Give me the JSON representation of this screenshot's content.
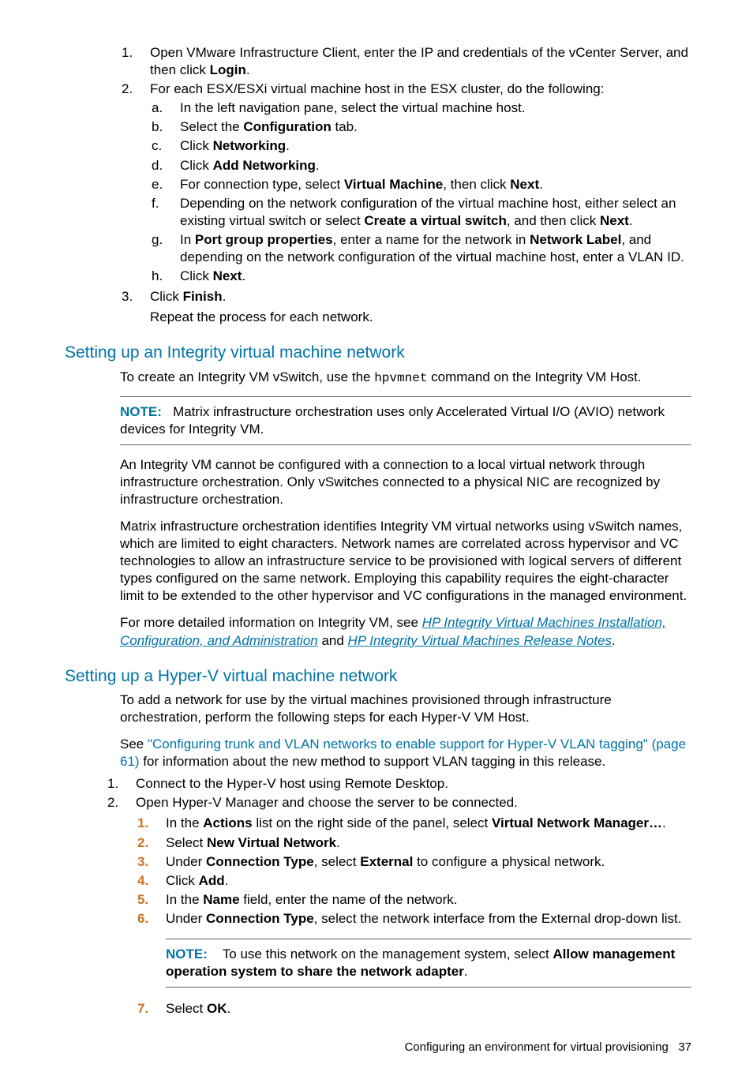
{
  "indent": {
    "l1_top": [
      {
        "n": "1.",
        "pre": "Open VMware Infrastructure Client, enter the IP and credentials of the vCenter Server, and then click ",
        "b1": "Login",
        "post": "."
      },
      {
        "n": "2.",
        "pre": "For each ESX/ESXi virtual machine host in the ESX cluster, do the following:"
      }
    ],
    "l2_letters": {
      "a": {
        "n": "a.",
        "txt": "In the left navigation pane, select the virtual machine host."
      },
      "b": {
        "n": "b.",
        "pre": "Select the ",
        "b1": "Configuration",
        "post": " tab."
      },
      "c": {
        "n": "c.",
        "pre": "Click ",
        "b1": "Networking",
        "post": "."
      },
      "d": {
        "n": "d.",
        "pre": "Click ",
        "b1": "Add Networking",
        "post": "."
      },
      "e": {
        "n": "e.",
        "pre": "For connection type, select ",
        "b1": "Virtual Machine",
        "mid": ", then click ",
        "b2": "Next",
        "post": "."
      },
      "f": {
        "n": "f.",
        "pre": "Depending on the network configuration of the virtual machine host, either select an existing virtual switch or select ",
        "b1": "Create a virtual switch",
        "mid": ", and then click ",
        "b2": "Next",
        "post": "."
      },
      "g": {
        "n": "g.",
        "pre": "In ",
        "b1": "Port group properties",
        "mid": ", enter a name for the network in ",
        "b2": "Network Label",
        "post": ", and depending on the network configuration of the virtual machine host, enter a VLAN ID."
      },
      "h": {
        "n": "h.",
        "pre": "Click ",
        "b1": "Next",
        "post": "."
      }
    },
    "l1_3": {
      "n": "3.",
      "pre": "Click ",
      "b1": "Finish",
      "post": "."
    },
    "l1_3_after": "Repeat the process for each network."
  },
  "s1": {
    "heading": "Setting up an Integrity virtual machine network",
    "intro_pre": "To create an Integrity VM vSwitch, use the ",
    "intro_code": "hpvmnet",
    "intro_post": " command on the Integrity VM Host.",
    "note_label": "NOTE:",
    "note_text": "Matrix infrastructure orchestration uses only Accelerated Virtual I/O (AVIO) network devices for Integrity VM.",
    "p2": "An Integrity VM cannot be configured with a connection to a local virtual network through infrastructure orchestration. Only vSwitches connected to a physical NIC are recognized by infrastructure orchestration.",
    "p3": "Matrix infrastructure orchestration identifies Integrity VM virtual networks using vSwitch names, which are limited to eight characters. Network names are correlated across hypervisor and VC technologies to allow an infrastructure service to be provisioned with logical servers of different types configured on the same network. Employing this capability requires the eight-character limit to be extended to the other hypervisor and VC configurations in the managed environment.",
    "p4_pre": "For more detailed information on Integrity VM, see ",
    "p4_link1": "HP Integrity Virtual Machines Installation, Configuration, and Administration",
    "p4_mid": " and ",
    "p4_link2": "HP Integrity Virtual Machines Release Notes",
    "p4_post": "."
  },
  "s2": {
    "heading": "Setting up a Hyper-V virtual machine network",
    "p1": "To add a network for use by the virtual machines provisioned through infrastructure orchestration, perform the following steps for each Hyper-V VM Host.",
    "p2_pre": "See ",
    "p2_xref": "\"Configuring trunk and VLAN networks to enable support for Hyper-V VLAN tagging\" (page 61)",
    "p2_post": " for information about the new method to support VLAN tagging in this release.",
    "l1": [
      {
        "n": "1.",
        "txt": "Connect to the Hyper-V host using Remote Desktop."
      },
      {
        "n": "2.",
        "txt": "Open Hyper-V Manager and choose the server to be connected."
      }
    ],
    "sub": {
      "1": {
        "n": "1.",
        "pre": "In the ",
        "b1": "Actions",
        "mid": " list on the right side of the panel, select ",
        "b2": "Virtual Network Manager…",
        "post": "."
      },
      "2": {
        "n": "2.",
        "pre": "Select ",
        "b1": "New Virtual Network",
        "post": "."
      },
      "3": {
        "n": "3.",
        "pre": "Under ",
        "b1": "Connection Type",
        "mid": ", select ",
        "b2": "External",
        "post": " to configure a physical network."
      },
      "4": {
        "n": "4.",
        "pre": "Click ",
        "b1": "Add",
        "post": "."
      },
      "5": {
        "n": "5.",
        "pre": "In the ",
        "b1": "Name",
        "post": " field, enter the name of the network."
      },
      "6": {
        "n": "6.",
        "pre": "Under ",
        "b1": "Connection Type",
        "post": ", select the network interface from the External drop-down list."
      },
      "note_label": "NOTE:",
      "note_pre": "To use this network on the management system, select ",
      "note_b": "Allow management operation system to share the network adapter",
      "note_post": ".",
      "7": {
        "n": "7.",
        "pre": "Select ",
        "b1": "OK",
        "post": "."
      }
    }
  },
  "footer": {
    "text": "Configuring an environment for virtual provisioning",
    "page": "37"
  }
}
